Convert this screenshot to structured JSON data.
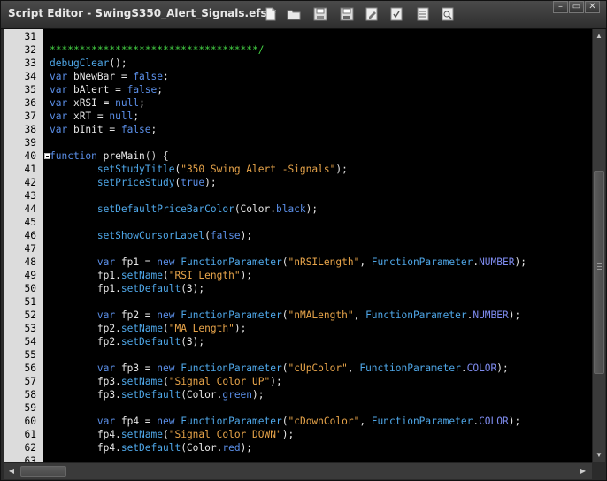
{
  "window": {
    "title": "Script Editor - SwingS350_Alert_Signals.efs *",
    "controls": {
      "minimize": "–",
      "restore": "▭",
      "close": "✕"
    }
  },
  "toolbar": {
    "icons": [
      "new-file-icon",
      "open-folder-icon",
      "save-icon",
      "save-all-icon",
      "edit-icon",
      "syntax-check-icon",
      "list-icon",
      "find-icon"
    ]
  },
  "colors": {
    "comment": "#44d044",
    "keyword": "#5b8fe8",
    "function": "#4fa7e8",
    "string": "#e7a44a",
    "number_const": "#7f8cf0",
    "background": "#000000",
    "gutter": "#dcdcdc"
  },
  "code_lines": [
    {
      "n": "31",
      "tokens": []
    },
    {
      "n": "32",
      "tokens": [
        [
          "c",
          "***********************************/"
        ]
      ]
    },
    {
      "n": "33",
      "tokens": [
        [
          "f",
          "debugClear"
        ],
        [
          "p",
          "();"
        ]
      ]
    },
    {
      "n": "34",
      "tokens": [
        [
          "k",
          "var "
        ],
        [
          "p",
          "bNewBar = "
        ],
        [
          "k",
          "false"
        ],
        [
          "p",
          ";"
        ]
      ]
    },
    {
      "n": "35",
      "tokens": [
        [
          "k",
          "var "
        ],
        [
          "p",
          "bAlert = "
        ],
        [
          "k",
          "false"
        ],
        [
          "p",
          ";"
        ]
      ]
    },
    {
      "n": "36",
      "tokens": [
        [
          "k",
          "var "
        ],
        [
          "p",
          "xRSI = "
        ],
        [
          "k",
          "null"
        ],
        [
          "p",
          ";"
        ]
      ]
    },
    {
      "n": "37",
      "tokens": [
        [
          "k",
          "var "
        ],
        [
          "p",
          "xRT = "
        ],
        [
          "k",
          "null"
        ],
        [
          "p",
          ";"
        ]
      ]
    },
    {
      "n": "38",
      "tokens": [
        [
          "k",
          "var "
        ],
        [
          "p",
          "bInit = "
        ],
        [
          "k",
          "false"
        ],
        [
          "p",
          ";"
        ]
      ]
    },
    {
      "n": "39",
      "tokens": []
    },
    {
      "n": "40",
      "fold": true,
      "tokens": [
        [
          "k",
          "function "
        ],
        [
          "p",
          "preMain"
        ],
        [
          "o",
          "() {"
        ]
      ]
    },
    {
      "n": "41",
      "tokens": [
        [
          "p",
          "        "
        ],
        [
          "f",
          "setStudyTitle"
        ],
        [
          "p",
          "("
        ],
        [
          "s",
          "\"350 Swing Alert -Signals\""
        ],
        [
          "p",
          ");"
        ]
      ]
    },
    {
      "n": "42",
      "tokens": [
        [
          "p",
          "        "
        ],
        [
          "f",
          "setPriceStudy"
        ],
        [
          "p",
          "("
        ],
        [
          "k",
          "true"
        ],
        [
          "p",
          ");"
        ]
      ]
    },
    {
      "n": "43",
      "tokens": []
    },
    {
      "n": "44",
      "tokens": [
        [
          "p",
          "        "
        ],
        [
          "f",
          "setDefaultPriceBarColor"
        ],
        [
          "p",
          "(Color."
        ],
        [
          "k",
          "black"
        ],
        [
          "p",
          ");"
        ]
      ]
    },
    {
      "n": "45",
      "tokens": []
    },
    {
      "n": "46",
      "tokens": [
        [
          "p",
          "        "
        ],
        [
          "f",
          "setShowCursorLabel"
        ],
        [
          "p",
          "("
        ],
        [
          "k",
          "false"
        ],
        [
          "p",
          ");"
        ]
      ]
    },
    {
      "n": "47",
      "tokens": []
    },
    {
      "n": "48",
      "tokens": [
        [
          "p",
          "        "
        ],
        [
          "k",
          "var "
        ],
        [
          "p",
          "fp1 = "
        ],
        [
          "k",
          "new "
        ],
        [
          "f",
          "FunctionParameter"
        ],
        [
          "p",
          "("
        ],
        [
          "s",
          "\"nRSILength\""
        ],
        [
          "p",
          ", "
        ],
        [
          "f",
          "FunctionParameter"
        ],
        [
          "p",
          "."
        ],
        [
          "n",
          "NUMBER"
        ],
        [
          "p",
          ");"
        ]
      ]
    },
    {
      "n": "49",
      "tokens": [
        [
          "p",
          "        fp1."
        ],
        [
          "f",
          "setName"
        ],
        [
          "p",
          "("
        ],
        [
          "s",
          "\"RSI Length\""
        ],
        [
          "p",
          ");"
        ]
      ]
    },
    {
      "n": "50",
      "tokens": [
        [
          "p",
          "        fp1."
        ],
        [
          "f",
          "setDefault"
        ],
        [
          "p",
          "(3);"
        ]
      ]
    },
    {
      "n": "51",
      "tokens": []
    },
    {
      "n": "52",
      "tokens": [
        [
          "p",
          "        "
        ],
        [
          "k",
          "var "
        ],
        [
          "p",
          "fp2 = "
        ],
        [
          "k",
          "new "
        ],
        [
          "f",
          "FunctionParameter"
        ],
        [
          "p",
          "("
        ],
        [
          "s",
          "\"nMALength\""
        ],
        [
          "p",
          ", "
        ],
        [
          "f",
          "FunctionParameter"
        ],
        [
          "p",
          "."
        ],
        [
          "n",
          "NUMBER"
        ],
        [
          "p",
          ");"
        ]
      ]
    },
    {
      "n": "53",
      "tokens": [
        [
          "p",
          "        fp2."
        ],
        [
          "f",
          "setName"
        ],
        [
          "p",
          "("
        ],
        [
          "s",
          "\"MA Length\""
        ],
        [
          "p",
          ");"
        ]
      ]
    },
    {
      "n": "54",
      "tokens": [
        [
          "p",
          "        fp2."
        ],
        [
          "f",
          "setDefault"
        ],
        [
          "p",
          "(3);"
        ]
      ]
    },
    {
      "n": "55",
      "tokens": []
    },
    {
      "n": "56",
      "tokens": [
        [
          "p",
          "        "
        ],
        [
          "k",
          "var "
        ],
        [
          "p",
          "fp3 = "
        ],
        [
          "k",
          "new "
        ],
        [
          "f",
          "FunctionParameter"
        ],
        [
          "p",
          "("
        ],
        [
          "s",
          "\"cUpColor\""
        ],
        [
          "p",
          ", "
        ],
        [
          "f",
          "FunctionParameter"
        ],
        [
          "p",
          "."
        ],
        [
          "n",
          "COLOR"
        ],
        [
          "p",
          ");"
        ]
      ]
    },
    {
      "n": "57",
      "tokens": [
        [
          "p",
          "        fp3."
        ],
        [
          "f",
          "setName"
        ],
        [
          "p",
          "("
        ],
        [
          "s",
          "\"Signal Color UP\""
        ],
        [
          "p",
          ");"
        ]
      ]
    },
    {
      "n": "58",
      "tokens": [
        [
          "p",
          "        fp3."
        ],
        [
          "f",
          "setDefault"
        ],
        [
          "p",
          "(Color."
        ],
        [
          "k",
          "green"
        ],
        [
          "p",
          ");"
        ]
      ]
    },
    {
      "n": "59",
      "tokens": []
    },
    {
      "n": "60",
      "tokens": [
        [
          "p",
          "        "
        ],
        [
          "k",
          "var "
        ],
        [
          "p",
          "fp4 = "
        ],
        [
          "k",
          "new "
        ],
        [
          "f",
          "FunctionParameter"
        ],
        [
          "p",
          "("
        ],
        [
          "s",
          "\"cDownColor\""
        ],
        [
          "p",
          ", "
        ],
        [
          "f",
          "FunctionParameter"
        ],
        [
          "p",
          "."
        ],
        [
          "n",
          "COLOR"
        ],
        [
          "p",
          ");"
        ]
      ]
    },
    {
      "n": "61",
      "tokens": [
        [
          "p",
          "        fp4."
        ],
        [
          "f",
          "setName"
        ],
        [
          "p",
          "("
        ],
        [
          "s",
          "\"Signal Color DOWN\""
        ],
        [
          "p",
          ");"
        ]
      ]
    },
    {
      "n": "62",
      "tokens": [
        [
          "p",
          "        fp4."
        ],
        [
          "f",
          "setDefault"
        ],
        [
          "p",
          "(Color."
        ],
        [
          "k",
          "red"
        ],
        [
          "p",
          ");"
        ]
      ]
    },
    {
      "n": "63",
      "tokens": []
    }
  ]
}
